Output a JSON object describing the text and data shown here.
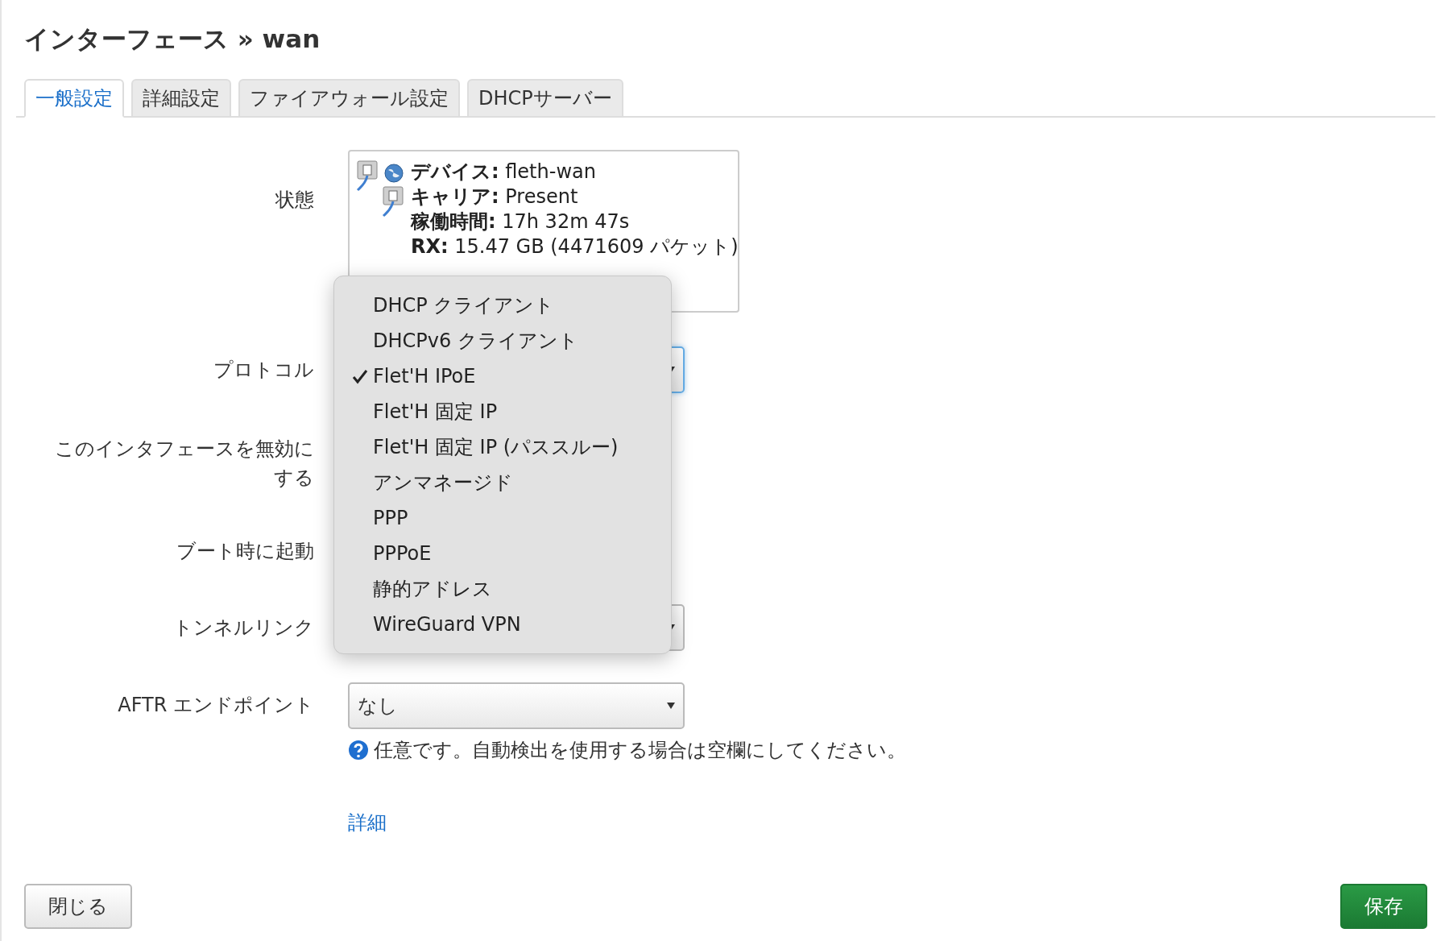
{
  "page_title": "インターフェース » wan",
  "tabs": [
    {
      "label": "一般設定",
      "selected": true
    },
    {
      "label": "詳細設定",
      "selected": false
    },
    {
      "label": "ファイアウォール設定",
      "selected": false
    },
    {
      "label": "DHCPサーバー",
      "selected": false
    }
  ],
  "status": {
    "label": "状態",
    "lines": [
      "**デバイス:** fleth-wan",
      "**キャリア:** Present",
      "**稼働時間:** 17h 32m 47s",
      "**RX:** 15.47 GB (4471609 パケット)"
    ]
  },
  "fields": [
    {
      "kind": "select",
      "label": "プロトコル",
      "focused": true
    },
    {
      "kind": "checkbox",
      "label": "このインタフェースを無効にする"
    },
    {
      "kind": "checkbox",
      "label": "ブート時に起動"
    },
    {
      "kind": "select",
      "label": "トンネルリンク",
      "focused": false
    },
    {
      "kind": "select",
      "label": "AFTR エンドポイント",
      "focused": false,
      "value": "なし",
      "help": "任意です。自動検出を使用する場合は空欄にしてください。"
    }
  ],
  "more_link": "詳細",
  "dropdown": {
    "options": [
      {
        "label": "DHCP クライアント",
        "selected": false
      },
      {
        "label": "DHCPv6 クライアント",
        "selected": false
      },
      {
        "label": "Flet'H IPoE",
        "selected": true
      },
      {
        "label": "Flet'H 固定 IP",
        "selected": false
      },
      {
        "label": "Flet'H 固定 IP (パススルー)",
        "selected": false
      },
      {
        "label": "アンマネージド",
        "selected": false
      },
      {
        "label": "PPP",
        "selected": false
      },
      {
        "label": "PPPoE",
        "selected": false
      },
      {
        "label": "静的アドレス",
        "selected": false
      },
      {
        "label": "WireGuard VPN",
        "selected": false
      }
    ]
  },
  "buttons": {
    "close": "閉じる",
    "save": "保存"
  }
}
